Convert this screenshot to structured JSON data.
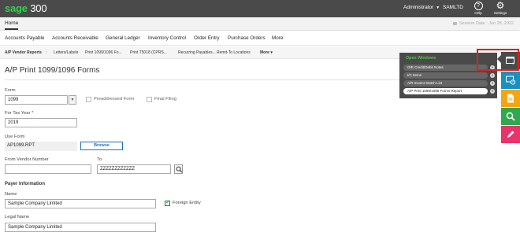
{
  "topbar": {
    "logo_sage": "sage",
    "logo_num": "300",
    "user": "Administrator",
    "company": "SAMLTD",
    "help_label": "Help",
    "settings_label": "Settings"
  },
  "homerow": {
    "home_tab": "Home",
    "session_date": "Session Date : Jun 28, 2022"
  },
  "modules": [
    "Accounts Payable",
    "Accounts Receivable",
    "General Ledger",
    "Inventory Control",
    "Order Entry",
    "Purchase Orders",
    "More"
  ],
  "tasks": [
    "A/P Vendor Reports",
    ":",
    "Letters/Labels",
    "Print 1099/1096 Fo...",
    "Print T5018 (CPRS...",
    "Recurring Payables...",
    "Remit-To Locations",
    "More ▾"
  ],
  "page": {
    "title": "A/P Print 1099/1096 Forms"
  },
  "form": {
    "form_label": "Form",
    "form_value": "1099",
    "preaddressed_label": "Preaddressed Form",
    "final_filing_label": "Final Filing",
    "tax_year_label": "For Tax Year",
    "tax_year_required": "*",
    "tax_year_value": "2019",
    "use_form_label": "Use Form",
    "use_form_value": "AP1099.RPT",
    "browse_label": "Browse",
    "from_vendor_label": "From Vendor Number",
    "from_vendor_value": "",
    "to_label": "To",
    "to_value": "ZZZZZZZZZZZZ",
    "payer_section": "Payer Information",
    "name_label": "Name",
    "name_value": "Sample Company Limited",
    "foreign_entity_label": "Foreign Entity",
    "foreign_entity_checked": true,
    "legal_name_label": "Legal Name",
    "legal_name_value": "Sample Company Limited"
  },
  "task_manager": {
    "title": "Open Windows",
    "items": [
      "O/E Credit/Debit Notes",
      "I/C Items",
      "A/R Invoice Batch List",
      "A/P Print 1099/1096 Forms Report"
    ],
    "active_index": 3
  },
  "right_bar": {
    "buttons": [
      {
        "icon": "open-windows-icon",
        "color": "#4a4a4a"
      },
      {
        "icon": "screen-clock-icon",
        "color": "#1b8fbf"
      },
      {
        "icon": "document-icon",
        "color": "#f2a614"
      },
      {
        "icon": "search-icon",
        "color": "#2fa84f"
      },
      {
        "icon": "pencil-icon",
        "color": "#e8336d"
      }
    ]
  }
}
